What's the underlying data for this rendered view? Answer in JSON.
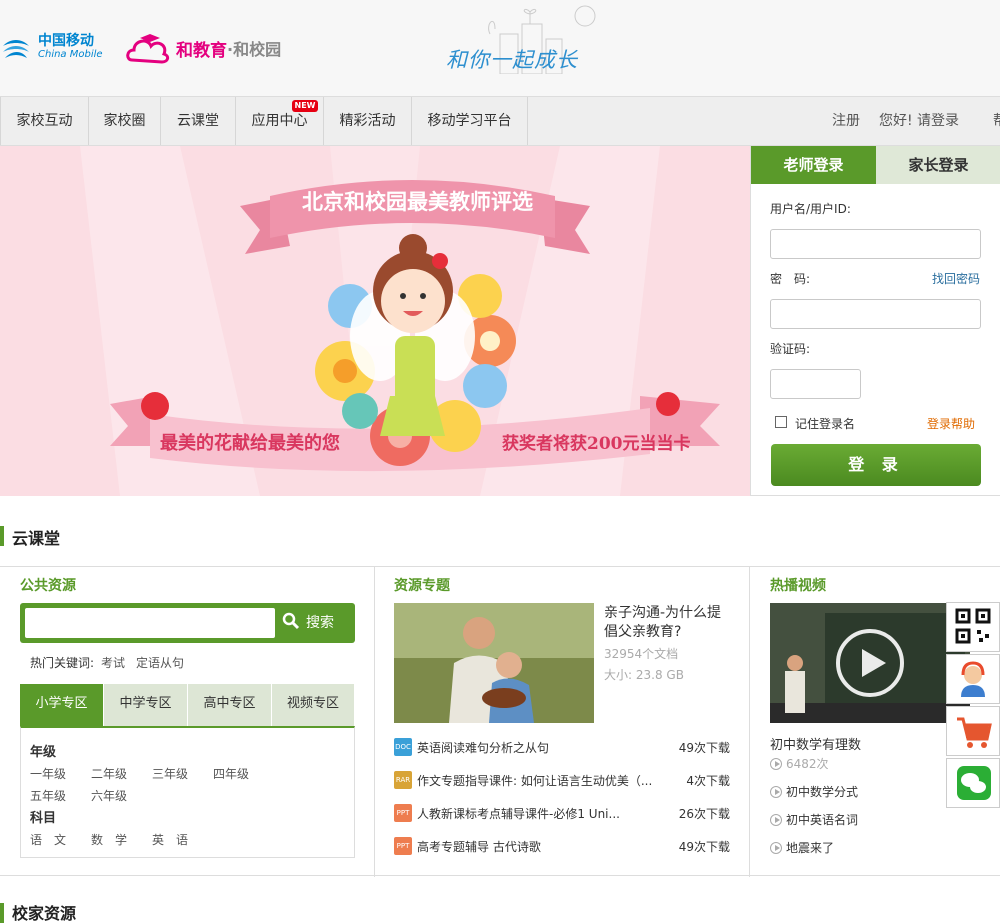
{
  "header": {
    "logo_cm_cn": "中国移动",
    "logo_cm_en": "China Mobile",
    "logo_he_main": "和教育",
    "logo_he_sub": "·和校园",
    "slogan": "和你一起成长"
  },
  "nav": {
    "items": [
      "家校互动",
      "家校圈",
      "云课堂",
      "应用中心",
      "精彩活动",
      "移动学习平台"
    ],
    "new_badge": "NEW",
    "register": "注册",
    "greeting": "您好! 请登录",
    "help": "帮"
  },
  "banner": {
    "title": "北京和校园最美教师评选",
    "left_text": "最美的花献给最美的您",
    "right_text": "获奖者将获200元当当卡"
  },
  "login": {
    "tab_teacher": "老师登录",
    "tab_parent": "家长登录",
    "username_label": "用户名/用户ID:",
    "password_label": "密　码:",
    "forgot_password": "找回密码",
    "captcha_label": "验证码:",
    "remember": "记住登录名",
    "login_help": "登录帮助",
    "login_button": "登 录"
  },
  "section1": {
    "title": "云课堂"
  },
  "public": {
    "title": "公共资源",
    "search_button": "搜索",
    "hot_label": "热门关键词:",
    "hot_words": [
      "考试",
      "定语从句"
    ],
    "zones": [
      "小学专区",
      "中学专区",
      "高中专区",
      "视频专区"
    ],
    "grade_label": "年级",
    "grades": [
      "一年级",
      "二年级",
      "三年级",
      "四年级",
      "五年级",
      "六年级"
    ],
    "subject_label": "科目",
    "subjects": [
      "语　文",
      "数　学",
      "英　语"
    ]
  },
  "topics": {
    "title": "资源专题",
    "feature_title": "亲子沟通-为什么提倡父亲教育?",
    "feature_docs": "32954个文档",
    "feature_size": "大小: 23.8 GB",
    "list": [
      {
        "type": "DOC",
        "color": "#3aa0d8",
        "name": "英语阅读难句分析之从句",
        "downloads": "49次下载"
      },
      {
        "type": "RAR",
        "color": "#d8a437",
        "name": "作文专题指导课件: 如何让语言生动优美（...",
        "downloads": "4次下载"
      },
      {
        "type": "PPT",
        "color": "#ee7d4f",
        "name": "人教新课标考点辅导课件-必修1 Uni...",
        "downloads": "26次下载"
      },
      {
        "type": "PPT",
        "color": "#ee7d4f",
        "name": "高考专题辅导 古代诗歌",
        "downloads": "49次下载"
      }
    ]
  },
  "videos": {
    "title": "热播视频",
    "feature_title": "初中数学有理数",
    "feature_plays": "6482次",
    "list": [
      "初中数学分式",
      "初中英语名词",
      "地震来了"
    ]
  },
  "floating": [
    "qrcode-icon",
    "customer-service-icon",
    "cart-icon",
    "wechat-icon"
  ],
  "section2": {
    "title": "校家资源"
  },
  "colors": {
    "brand_green": "#5a9a2a",
    "cm_blue": "#0085d0",
    "he_pink": "#e4007f"
  }
}
